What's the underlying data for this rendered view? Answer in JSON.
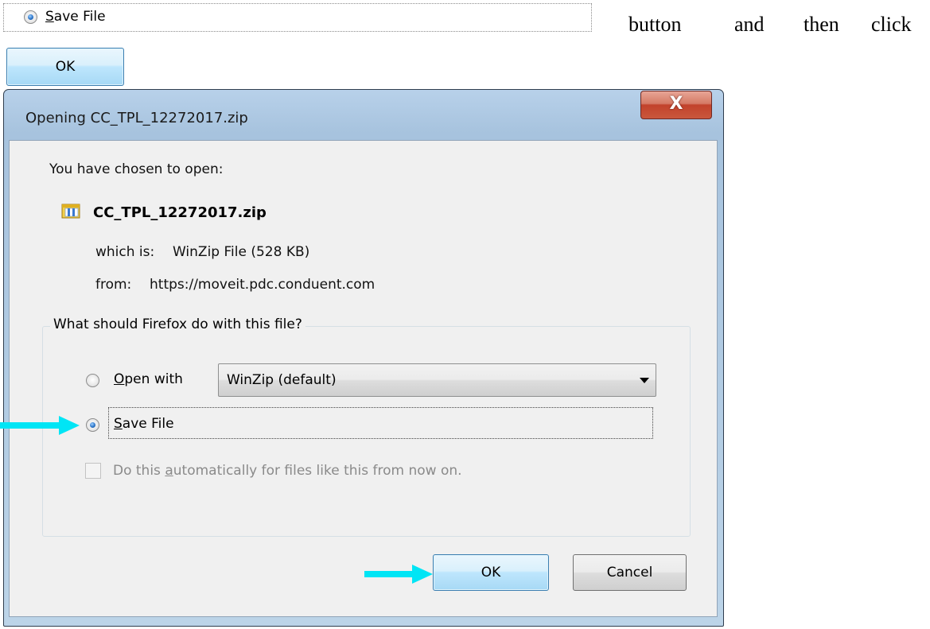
{
  "snippet": {
    "save_file_label_first": "S",
    "save_file_label_rest": "ave File",
    "ok_label": "OK"
  },
  "document_text": {
    "words": [
      "button",
      "and",
      "then",
      "click"
    ]
  },
  "dialog": {
    "title": "Opening CC_TPL_12272017.zip",
    "close_glyph": "X",
    "prompt": "You have chosen to open:",
    "file_name": "CC_TPL_12272017.zip",
    "which_is_label": "which is:",
    "which_is_value": "WinZip File (528 KB)",
    "from_label": "from:",
    "from_value": "https://moveit.pdc.conduent.com",
    "question": "What should Firefox do with this file?",
    "open_with_first": "O",
    "open_with_rest": "pen with",
    "open_with_app": "WinZip (default)",
    "save_file_first": "S",
    "save_file_rest": "ave File",
    "auto_before": "Do this ",
    "auto_underlined": "a",
    "auto_after": "utomatically for files like this from now on.",
    "ok_label": "OK",
    "cancel_label": "Cancel"
  },
  "state": {
    "selected_option": "Save File",
    "open_with_selected": false,
    "auto_checkbox_checked": false,
    "auto_checkbox_enabled": false
  },
  "colors": {
    "annotation_arrow": "#00e5f5",
    "focus_button_border": "#3c7fb1",
    "close_button": "#c2422c",
    "dialog_background": "#f0f0f0"
  },
  "icons": [
    "zip-file-icon",
    "close-icon",
    "dropdown-arrow-icon",
    "pointer-arrow-icon"
  ]
}
